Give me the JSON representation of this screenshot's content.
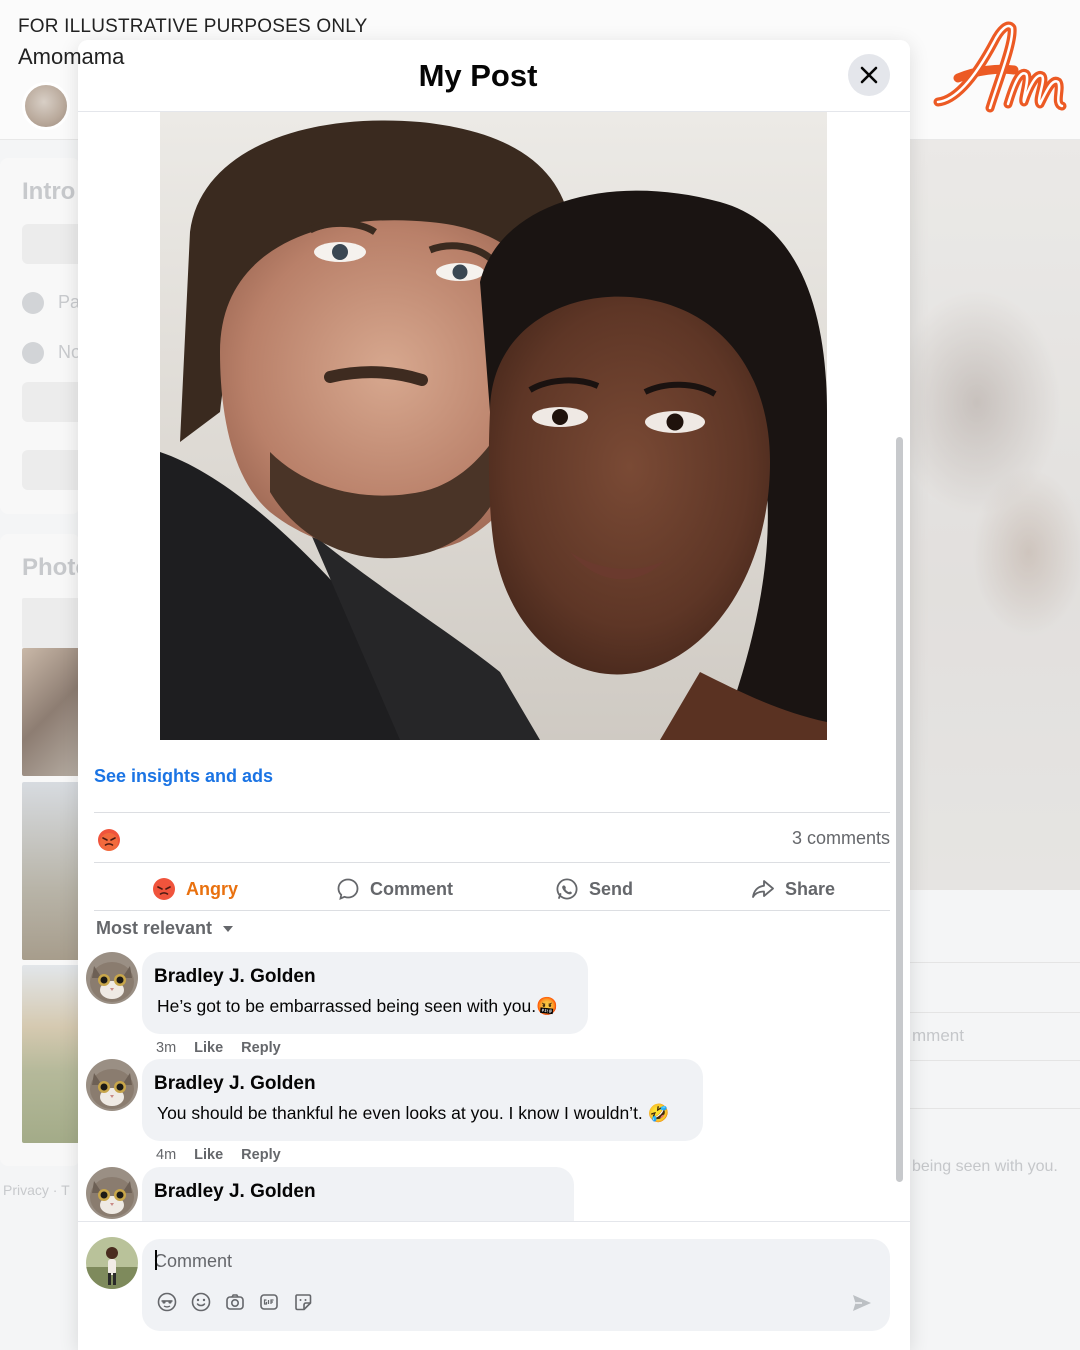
{
  "watermark": {
    "notice": "FOR ILLUSTRATIVE PURPOSES ONLY",
    "brand": "Amomama"
  },
  "background": {
    "intro_title": "Intro",
    "intro_row1": "Pa",
    "intro_row2": "No",
    "photos_title": "Photo",
    "footer": "Privacy · T",
    "right_comment_label": "mment",
    "right_snippet": "being seen with you."
  },
  "modal": {
    "title": "My Post",
    "insights_link": "See insights and ads",
    "comments_count": "3 comments",
    "actions": {
      "angry": "Angry",
      "comment": "Comment",
      "send": "Send",
      "share": "Share"
    },
    "sort_label": "Most relevant",
    "comments": [
      {
        "author": "Bradley J. Golden",
        "text": "He’s got to be embarrassed being seen with you.🤬",
        "time": "3m",
        "like": "Like",
        "reply": "Reply"
      },
      {
        "author": "Bradley J. Golden",
        "text": "You should be thankful he even looks at you. I know I wouldn’t. 🤣",
        "time": "4m",
        "like": "Like",
        "reply": "Reply"
      },
      {
        "author": "Bradley J. Golden",
        "text": "",
        "time": "",
        "like": "",
        "reply": ""
      }
    ],
    "composer": {
      "placeholder": "Comment"
    }
  },
  "colors": {
    "link": "#1b74e4",
    "angry": "#e9710f",
    "brand_logo": "#ec5a24",
    "bubble": "#f0f2f5"
  },
  "icons": [
    "close-icon",
    "angry-emoji-icon",
    "comment-icon",
    "messenger-icon",
    "share-icon",
    "chevron-down-icon",
    "avatar-sticker-icon",
    "emoji-icon",
    "camera-icon",
    "gif-icon",
    "sticker-icon",
    "send-arrow-icon"
  ]
}
